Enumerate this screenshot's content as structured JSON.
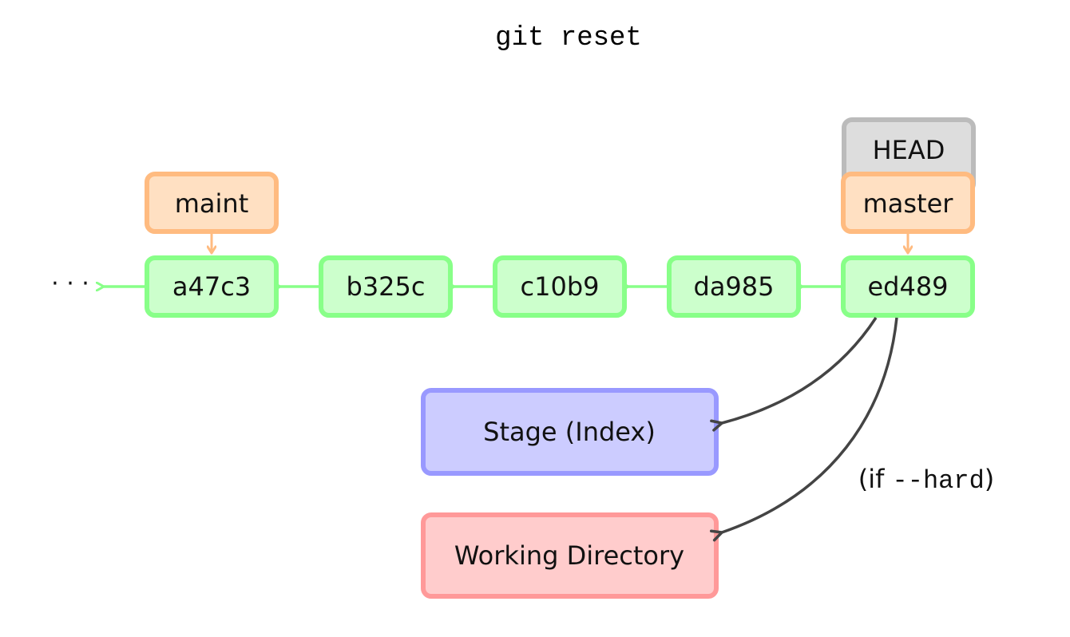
{
  "title": "git reset",
  "ellipsis": "· · ·",
  "colors": {
    "commit_fill": "#ccffcc",
    "commit_stroke": "#88ff88",
    "branch_fill": "#ffe0c2",
    "branch_stroke": "#ffbb80",
    "head_fill": "#dddddd",
    "head_stroke": "#bbbbbb",
    "stage_fill": "#ccccff",
    "stage_stroke": "#9999ff",
    "workdir_fill": "#ffcccc",
    "workdir_stroke": "#ff9999",
    "reset_arrow": "#444444"
  },
  "commits": [
    {
      "id": "a47c3"
    },
    {
      "id": "b325c"
    },
    {
      "id": "c10b9"
    },
    {
      "id": "da985"
    },
    {
      "id": "ed489"
    }
  ],
  "branches": [
    {
      "name": "maint",
      "target": "a47c3"
    },
    {
      "name": "master",
      "target": "ed489"
    }
  ],
  "head": {
    "label": "HEAD",
    "points_to": "master"
  },
  "areas": {
    "stage": "Stage (Index)",
    "working_directory": "Working Directory"
  },
  "annotation": {
    "prefix": "(if ",
    "flag": "--hard",
    "suffix": ")"
  }
}
